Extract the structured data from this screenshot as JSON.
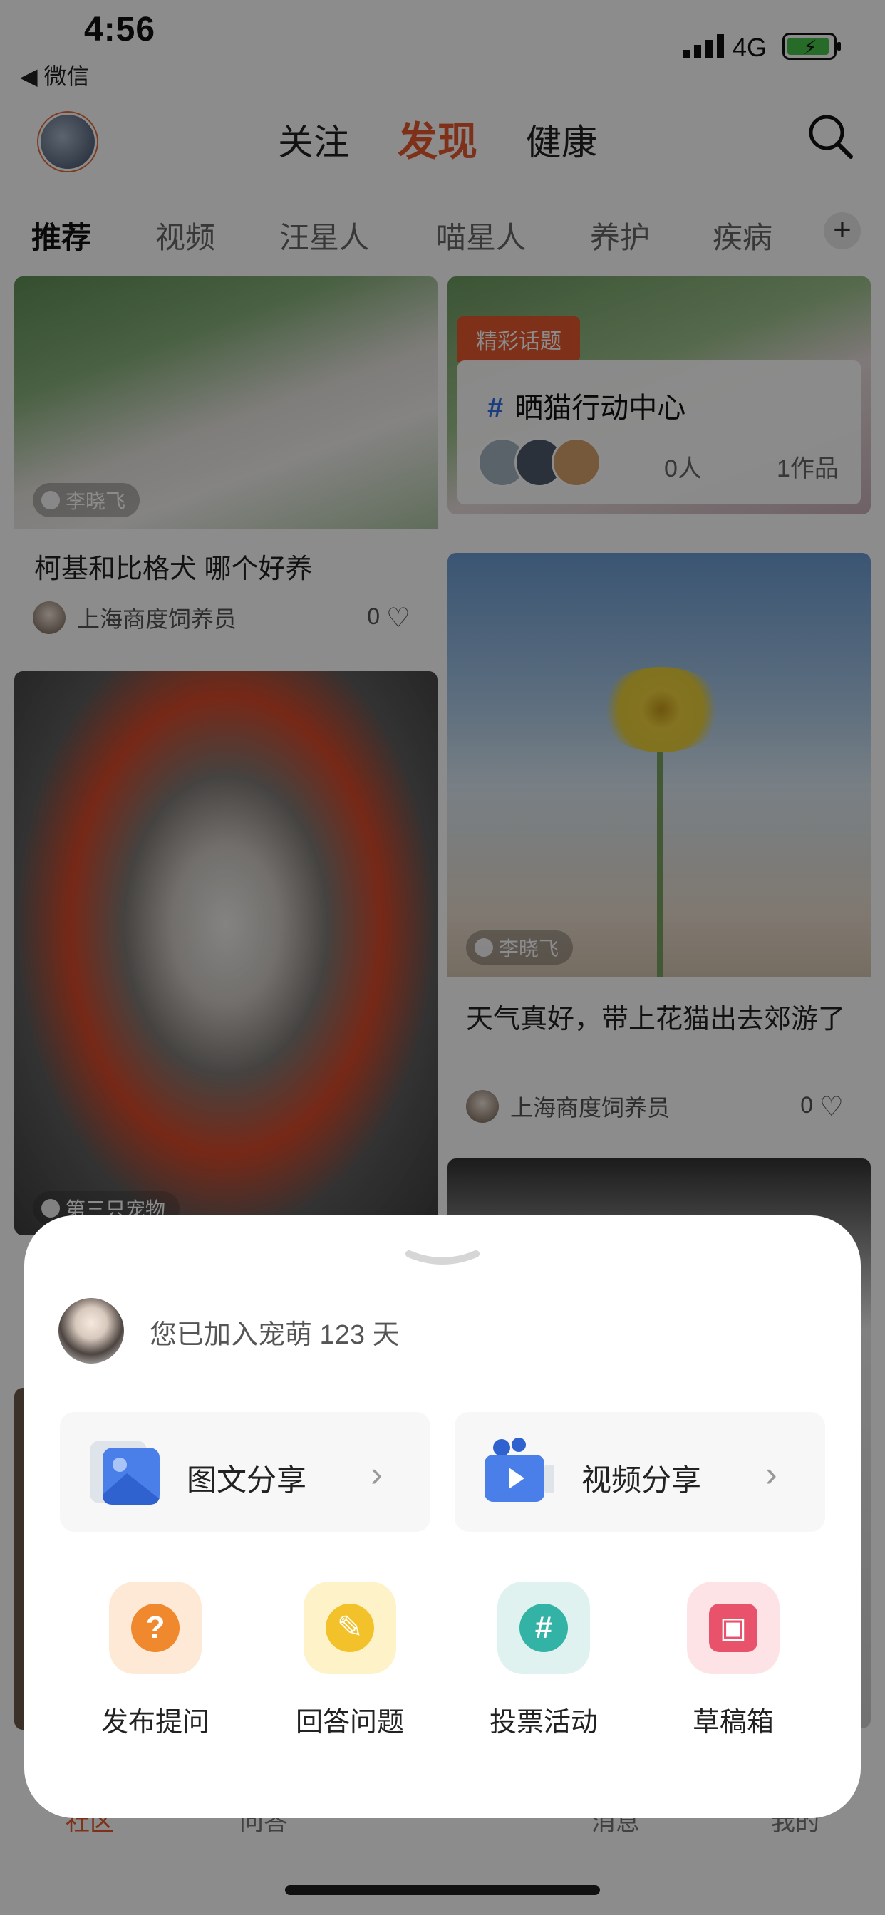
{
  "status_bar": {
    "time": "4:56",
    "back_label": "◀ 微信",
    "network": "4G"
  },
  "header": {
    "tabs": [
      "关注",
      "发现",
      "健康"
    ],
    "active_tab": "发现"
  },
  "categories": {
    "items": [
      "推荐",
      "视频",
      "汪星人",
      "喵星人",
      "养护",
      "疾病"
    ],
    "add_label": "+"
  },
  "feed": {
    "left": [
      {
        "author_chip": "李晓飞",
        "title": "柯基和比格犬 哪个好养",
        "user": "上海商度饲养员",
        "likes": "0"
      },
      {
        "author_chip": "第三只宠物"
      }
    ],
    "right": [
      {
        "topic_badge": "精彩话题",
        "topic_title": "晒猫行动中心",
        "people": "0人",
        "works": "1作品"
      },
      {
        "author_chip": "李晓飞",
        "title": "天气真好，带上花猫出去郊游了",
        "user": "上海商度饲养员",
        "likes": "0"
      }
    ]
  },
  "bottom_nav": {
    "items": [
      "社区",
      "问答",
      "消息",
      "我的"
    ]
  },
  "sheet": {
    "joined_text": "您已加入宠萌 123 天",
    "share": [
      {
        "label": "图文分享",
        "icon": "image-icon"
      },
      {
        "label": "视频分享",
        "icon": "video-icon"
      }
    ],
    "actions": [
      {
        "label": "发布提问",
        "icon": "question-icon",
        "glyph": "?",
        "bg": "#fde9d6",
        "fg": "#f0892d"
      },
      {
        "label": "回答问题",
        "icon": "pen-icon",
        "glyph": "✎",
        "bg": "#fdf2c8",
        "fg": "#f3c12a"
      },
      {
        "label": "投票活动",
        "icon": "hash-icon",
        "glyph": "#",
        "bg": "#dff2ef",
        "fg": "#33b3a6"
      },
      {
        "label": "草稿箱",
        "icon": "draft-icon",
        "glyph": "▣",
        "bg": "#fde3e6",
        "fg": "#e8536b"
      }
    ]
  },
  "colors": {
    "accent": "#e5582c",
    "topic_hash": "#2f6fe8"
  }
}
